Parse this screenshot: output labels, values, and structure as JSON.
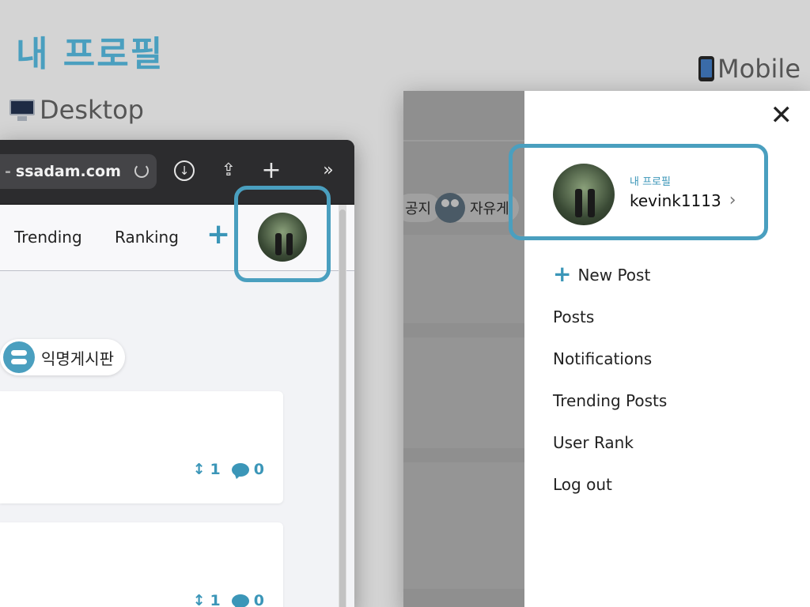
{
  "slide": {
    "title": "내 프로필",
    "desktop_label": "Desktop",
    "mobile_label": "Mobile"
  },
  "desktop": {
    "url": "ssadam.com",
    "toolbar_icons": [
      "download-icon",
      "share-icon",
      "plus-icon",
      "chevron-right-double-icon"
    ],
    "nav": {
      "trending": "Trending",
      "ranking": "Ranking",
      "plus": "+"
    },
    "board_chip": "익명게시판",
    "posts": [
      {
        "votes": "1",
        "comments": "0"
      },
      {
        "votes": "1",
        "comments": "0"
      }
    ]
  },
  "mobile": {
    "bg_chips": [
      "공지",
      "자유게"
    ],
    "profile": {
      "caption": "내 프로필",
      "username": "kevink1113"
    },
    "menu": [
      {
        "label": "New Post",
        "icon": "plus-icon"
      },
      {
        "label": "Posts"
      },
      {
        "label": "Notifications"
      },
      {
        "label": "Trending Posts"
      },
      {
        "label": "User Rank"
      },
      {
        "label": "Log out"
      }
    ]
  },
  "colors": {
    "accent": "#4a9fbf",
    "background": "#d4d4d4"
  }
}
